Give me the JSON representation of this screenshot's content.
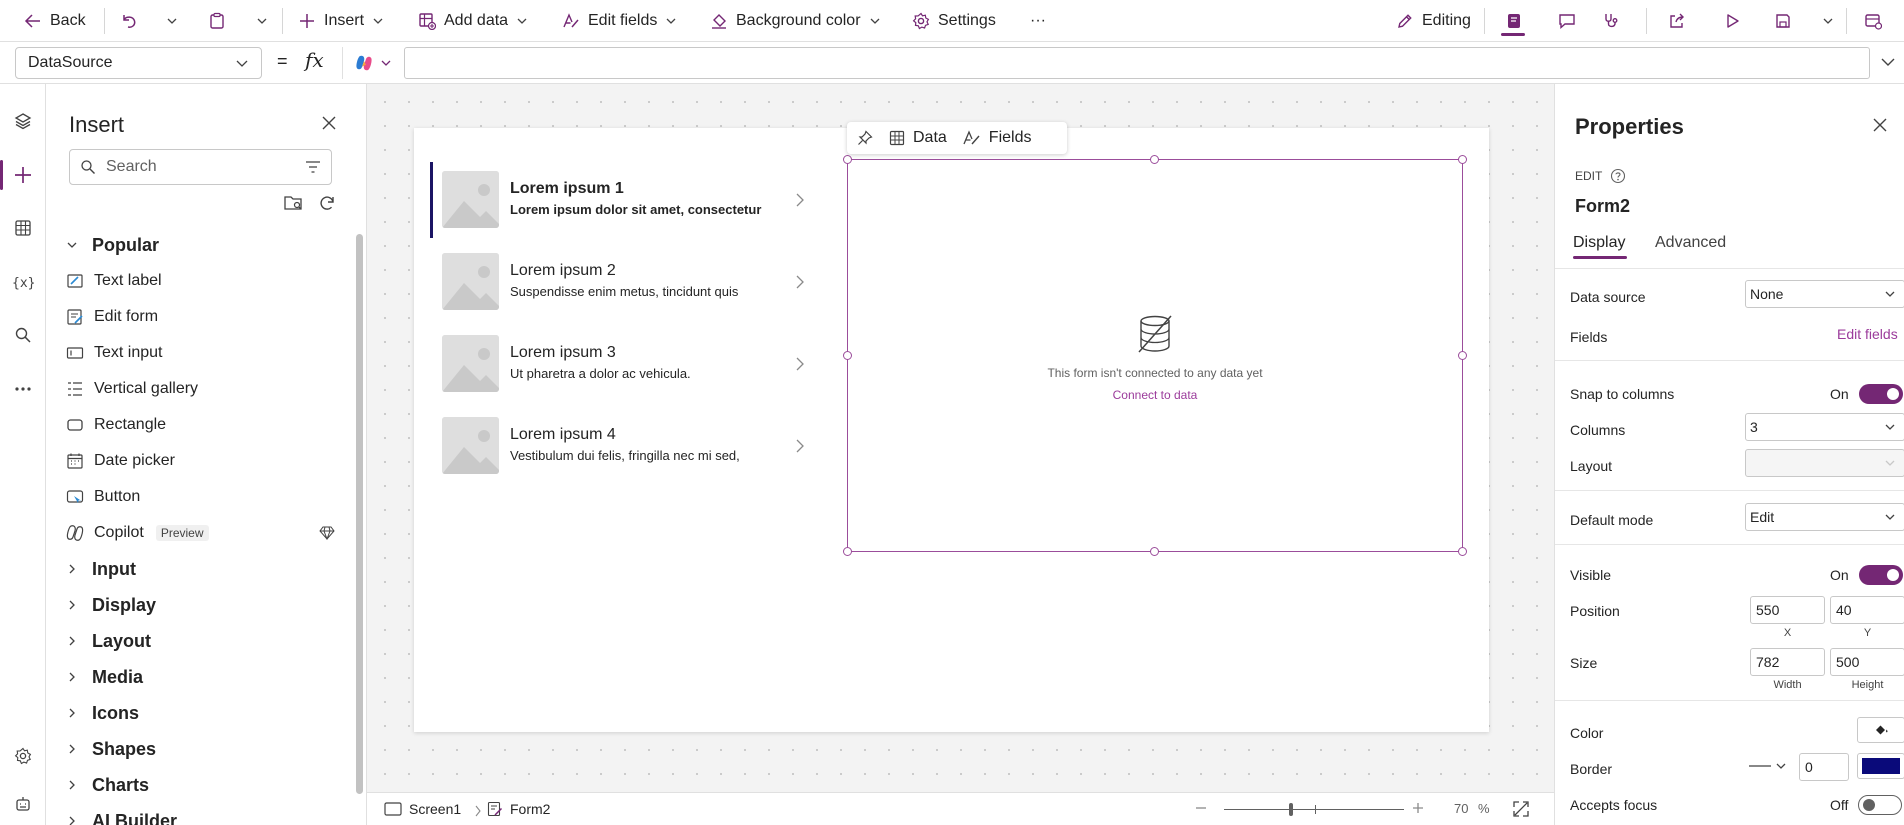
{
  "toolbar": {
    "back": "Back",
    "insert": "Insert",
    "add_data": "Add data",
    "edit_fields": "Edit fields",
    "background_color": "Background color",
    "settings": "Settings",
    "more": "···",
    "editing": "Editing"
  },
  "formula_bar": {
    "property": "DataSource",
    "equals": "=",
    "fx": "fx",
    "formula": ""
  },
  "insert_pane": {
    "title": "Insert",
    "search_placeholder": "Search",
    "categories": {
      "popular": "Popular",
      "input": "Input",
      "display": "Display",
      "layout": "Layout",
      "media": "Media",
      "icons": "Icons",
      "shapes": "Shapes",
      "charts": "Charts",
      "ai_builder": "AI Builder"
    },
    "items": {
      "text_label": "Text label",
      "edit_form": "Edit form",
      "text_input": "Text input",
      "vertical_gallery": "Vertical gallery",
      "rectangle": "Rectangle",
      "date_picker": "Date picker",
      "button": "Button",
      "copilot": "Copilot",
      "copilot_badge": "Preview"
    }
  },
  "gallery": {
    "items": [
      {
        "title": "Lorem ipsum 1",
        "subtitle": "Lorem ipsum dolor sit amet, consectetur"
      },
      {
        "title": "Lorem ipsum 2",
        "subtitle": "Suspendisse enim metus, tincidunt quis"
      },
      {
        "title": "Lorem ipsum 3",
        "subtitle": "Ut pharetra a dolor ac vehicula."
      },
      {
        "title": "Lorem ipsum 4",
        "subtitle": "Vestibulum dui felis, fringilla nec mi sed,"
      }
    ]
  },
  "form": {
    "toolbar_data": "Data",
    "toolbar_fields": "Fields",
    "empty_message": "This form isn't connected to any data yet",
    "connect_link": "Connect to data"
  },
  "status_bar": {
    "screen": "Screen1",
    "control": "Form2",
    "zoom_value": "70",
    "zoom_unit": "%"
  },
  "properties": {
    "title": "Properties",
    "edit_label": "EDIT",
    "control_name": "Form2",
    "tab_display": "Display",
    "tab_advanced": "Advanced",
    "data_source_label": "Data source",
    "data_source_value": "None",
    "fields_label": "Fields",
    "edit_fields_link": "Edit fields",
    "snap_label": "Snap to columns",
    "snap_value": "On",
    "columns_label": "Columns",
    "columns_value": "3",
    "layout_label": "Layout",
    "layout_value": "",
    "default_mode_label": "Default mode",
    "default_mode_value": "Edit",
    "visible_label": "Visible",
    "visible_value": "On",
    "position_label": "Position",
    "position_x": "550",
    "position_y": "40",
    "position_x_caption": "X",
    "position_y_caption": "Y",
    "size_label": "Size",
    "size_width": "782",
    "size_height": "500",
    "size_width_caption": "Width",
    "size_height_caption": "Height",
    "color_label": "Color",
    "border_label": "Border",
    "border_width": "0",
    "border_color": "#0a0a7a",
    "accepts_focus_label": "Accepts focus",
    "accepts_focus_value": "Off"
  },
  "colors": {
    "accent": "#742774",
    "link": "#9b3b9b",
    "gallery_selected": "#1b1464"
  }
}
